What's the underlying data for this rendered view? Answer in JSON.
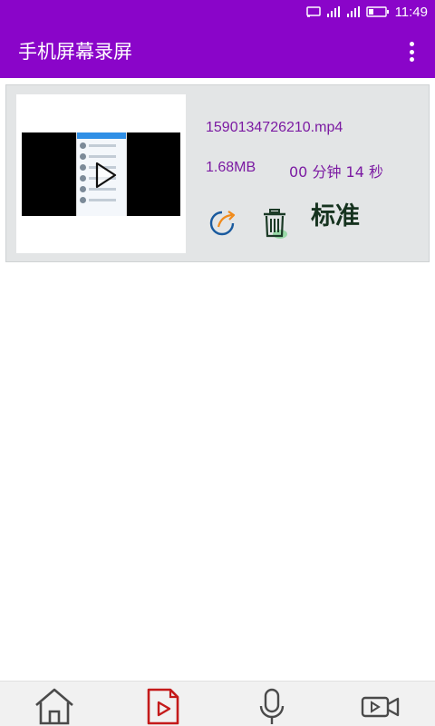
{
  "status_bar": {
    "time": "11:49",
    "colors": {
      "background": "#8a05c9"
    },
    "icons": [
      "cast-icon",
      "signal-icon",
      "signal-icon",
      "battery-icon"
    ]
  },
  "app_bar": {
    "title": "手机屏幕录屏",
    "menu_icon": "more-vert-icon",
    "colors": {
      "background": "#8a05c9",
      "text": "#ffffff"
    }
  },
  "recordings": [
    {
      "file_name": "1590134726210.mp4",
      "file_size": "1.68MB",
      "duration": "00 分钟 14 秒",
      "quality": "标准",
      "icons": [
        "play-icon",
        "share-icon",
        "trash-icon"
      ]
    }
  ],
  "bottom_nav": {
    "items": [
      {
        "icon": "home-icon",
        "active": false
      },
      {
        "icon": "video-file-icon",
        "active": true
      },
      {
        "icon": "microphone-icon",
        "active": false
      },
      {
        "icon": "video-camera-icon",
        "active": false
      }
    ],
    "colors": {
      "active": "#c41a1a",
      "inactive": "#4a4a4a"
    }
  },
  "colors": {
    "card_background": "#e3e5e6",
    "meta_text": "#7b1aa2",
    "quality_text": "#16331f"
  }
}
